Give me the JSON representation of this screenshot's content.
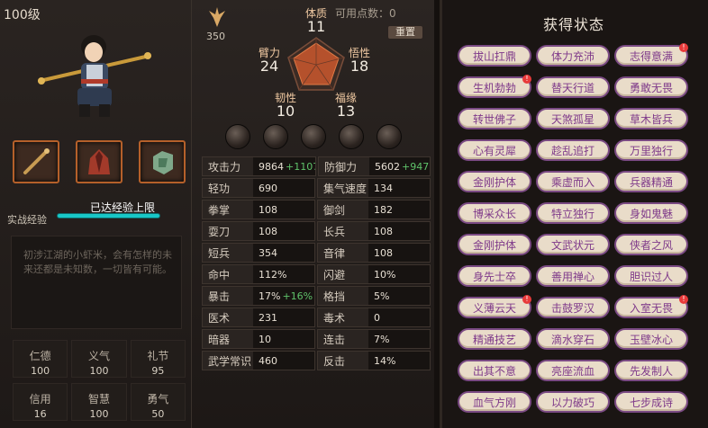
{
  "profile": {
    "level": "100级",
    "exp_max": "已达经验上限",
    "exp_label": "实战经验",
    "bio": "初涉江湖的小虾米，会有怎样的未来还都是未知数，一切皆有可能。"
  },
  "equipment": [
    {
      "icon": "staff-icon"
    },
    {
      "icon": "robe-icon"
    },
    {
      "icon": "jade-accessory-icon"
    }
  ],
  "virtues": [
    {
      "name": "仁德",
      "value": "100"
    },
    {
      "name": "义气",
      "value": "100"
    },
    {
      "name": "礼节",
      "value": "95"
    },
    {
      "name": "信用",
      "value": "16"
    },
    {
      "name": "智慧",
      "value": "100"
    },
    {
      "name": "勇气",
      "value": "50"
    }
  ],
  "power": {
    "value": "350"
  },
  "points": {
    "label": "可用点数：",
    "value": "0"
  },
  "reset_label": "重置",
  "attributes": [
    {
      "name": "体质",
      "value": "11"
    },
    {
      "name": "悟性",
      "value": "18"
    },
    {
      "name": "福缘",
      "value": "13"
    },
    {
      "name": "韧性",
      "value": "10"
    },
    {
      "name": "臂力",
      "value": "24"
    }
  ],
  "stats": [
    [
      {
        "name": "攻击力",
        "value": "9864",
        "bonus": "+1107"
      },
      {
        "name": "防御力",
        "value": "5602",
        "bonus": "+947"
      }
    ],
    [
      {
        "name": "轻功",
        "value": "690",
        "bonus": ""
      },
      {
        "name": "集气速度",
        "value": "134",
        "bonus": ""
      }
    ],
    [
      {
        "name": "拳掌",
        "value": "108",
        "bonus": ""
      },
      {
        "name": "御剑",
        "value": "182",
        "bonus": ""
      }
    ],
    [
      {
        "name": "耍刀",
        "value": "108",
        "bonus": ""
      },
      {
        "name": "长兵",
        "value": "108",
        "bonus": ""
      }
    ],
    [
      {
        "name": "短兵",
        "value": "354",
        "bonus": ""
      },
      {
        "name": "音律",
        "value": "108",
        "bonus": ""
      }
    ],
    [
      {
        "name": "命中",
        "value": "112%",
        "bonus": ""
      },
      {
        "name": "闪避",
        "value": "10%",
        "bonus": ""
      }
    ],
    [
      {
        "name": "暴击",
        "value": "17%",
        "bonus": "+16%"
      },
      {
        "name": "格挡",
        "value": "5%",
        "bonus": ""
      }
    ],
    [
      {
        "name": "医术",
        "value": "231",
        "bonus": ""
      },
      {
        "name": "毒术",
        "value": "0",
        "bonus": ""
      }
    ],
    [
      {
        "name": "暗器",
        "value": "10",
        "bonus": ""
      },
      {
        "name": "连击",
        "value": "7%",
        "bonus": ""
      }
    ],
    [
      {
        "name": "武学常识",
        "value": "460",
        "bonus": ""
      },
      {
        "name": "反击",
        "value": "14%",
        "bonus": ""
      }
    ]
  ],
  "status_title": "获得状态",
  "statuses": [
    {
      "label": "拔山扛鼎",
      "badge": ""
    },
    {
      "label": "体力充沛",
      "badge": ""
    },
    {
      "label": "志得意满",
      "badge": "!"
    },
    {
      "label": "生机勃勃",
      "badge": "!"
    },
    {
      "label": "替天行道",
      "badge": ""
    },
    {
      "label": "勇敢无畏",
      "badge": ""
    },
    {
      "label": "转世佛子",
      "badge": ""
    },
    {
      "label": "天煞孤星",
      "badge": ""
    },
    {
      "label": "草木皆兵",
      "badge": ""
    },
    {
      "label": "心有灵犀",
      "badge": ""
    },
    {
      "label": "趁乱追打",
      "badge": ""
    },
    {
      "label": "万里独行",
      "badge": ""
    },
    {
      "label": "金刚护体",
      "badge": ""
    },
    {
      "label": "乘虚而入",
      "badge": ""
    },
    {
      "label": "兵器精通",
      "badge": ""
    },
    {
      "label": "博采众长",
      "badge": ""
    },
    {
      "label": "特立独行",
      "badge": ""
    },
    {
      "label": "身如鬼魅",
      "badge": ""
    },
    {
      "label": "金刚护体",
      "badge": ""
    },
    {
      "label": "文武状元",
      "badge": ""
    },
    {
      "label": "侠者之风",
      "badge": ""
    },
    {
      "label": "身先士卒",
      "badge": ""
    },
    {
      "label": "善用禅心",
      "badge": ""
    },
    {
      "label": "胆识过人",
      "badge": ""
    },
    {
      "label": "义薄云天",
      "badge": "!"
    },
    {
      "label": "击鼓罗汉",
      "badge": ""
    },
    {
      "label": "入室无畏",
      "badge": "!"
    },
    {
      "label": "精通技艺",
      "badge": ""
    },
    {
      "label": "滴水穿石",
      "badge": ""
    },
    {
      "label": "玉壁冰心",
      "badge": ""
    },
    {
      "label": "出其不意",
      "badge": ""
    },
    {
      "label": "亮座流血",
      "badge": ""
    },
    {
      "label": "先发制人",
      "badge": ""
    },
    {
      "label": "血气方刚",
      "badge": ""
    },
    {
      "label": "以力破巧",
      "badge": ""
    },
    {
      "label": "七步成诗",
      "badge": ""
    }
  ],
  "colors": {
    "exp_bar": "#18c7c7",
    "status_text": "#7f3a8a",
    "bonus": "#5fc26a",
    "badge": "#e83a3a"
  }
}
